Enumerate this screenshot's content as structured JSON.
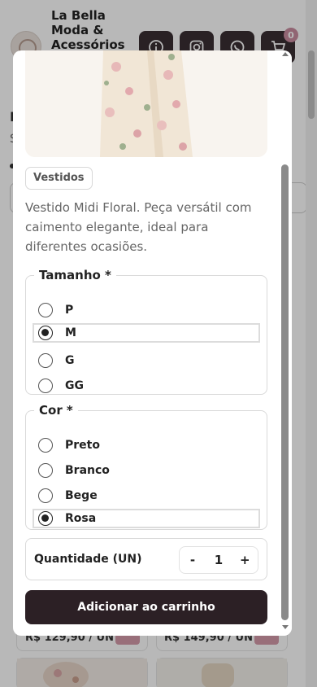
{
  "header": {
    "store_name": "La Bella Moda & Acessórios",
    "buttons": [
      {
        "icon": "info-icon"
      },
      {
        "icon": "instagram-icon"
      },
      {
        "icon": "whatsapp-icon"
      },
      {
        "icon": "cart-icon"
      }
    ],
    "cart_count": "0"
  },
  "background": {
    "filter_title": "I",
    "filter_subtitle": "S",
    "products": [
      {
        "price": "R$ 129,90 / UN"
      },
      {
        "price": "R$ 149,90 / UN"
      }
    ]
  },
  "modal": {
    "category": "Vestidos",
    "description": "Vestido Midi Floral. Peça versátil com caimento elegante, ideal para diferentes ocasiões.",
    "size_group": {
      "legend": "Tamanho *",
      "options": [
        "P",
        "M",
        "G",
        "GG"
      ],
      "selected": "M"
    },
    "color_group": {
      "legend": "Cor *",
      "options": [
        "Preto",
        "Branco",
        "Bege",
        "Rosa"
      ],
      "selected": "Rosa"
    },
    "quantity": {
      "label": "Quantidade (UN)",
      "decrement": "-",
      "value": "1",
      "increment": "+"
    },
    "add_button": "Adicionar ao carrinho"
  },
  "colors": {
    "brand_dark": "#2c2025",
    "header_button": "#3a2e33",
    "badge": "#c98da0"
  }
}
